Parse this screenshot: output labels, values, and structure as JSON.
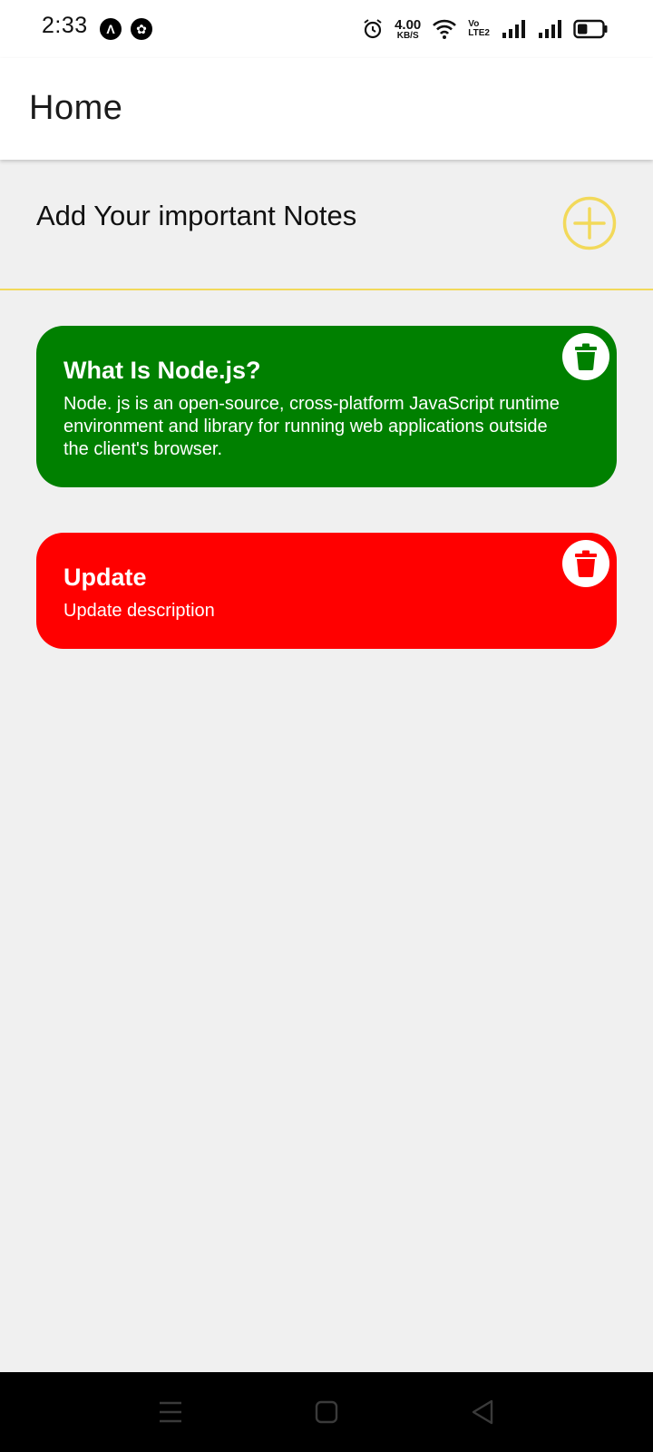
{
  "status_bar": {
    "time": "2:33",
    "app_icons": [
      "Λ",
      "✿"
    ],
    "net_speed_value": "4.00",
    "net_speed_unit": "KB/S",
    "volte_top": "Vo",
    "volte_bottom": "LTE2",
    "battery_level": 0.4
  },
  "app_bar": {
    "title": "Home"
  },
  "add_section": {
    "label": "Add Your important Notes",
    "button_icon": "plus-circle-icon",
    "accent_color": "#f2d95a"
  },
  "notes": [
    {
      "title": "What Is Node.js?",
      "description": "Node. js is an open-source, cross-platform JavaScript runtime environment and library for running web applications outside the client's browser.",
      "color": "#008000",
      "delete_icon": "trash-icon"
    },
    {
      "title": "Update",
      "description": "Update description",
      "color": "#ff0000",
      "delete_icon": "trash-icon"
    }
  ],
  "nav_bar": {
    "buttons": [
      "menu-icon",
      "home-icon",
      "back-icon"
    ]
  }
}
